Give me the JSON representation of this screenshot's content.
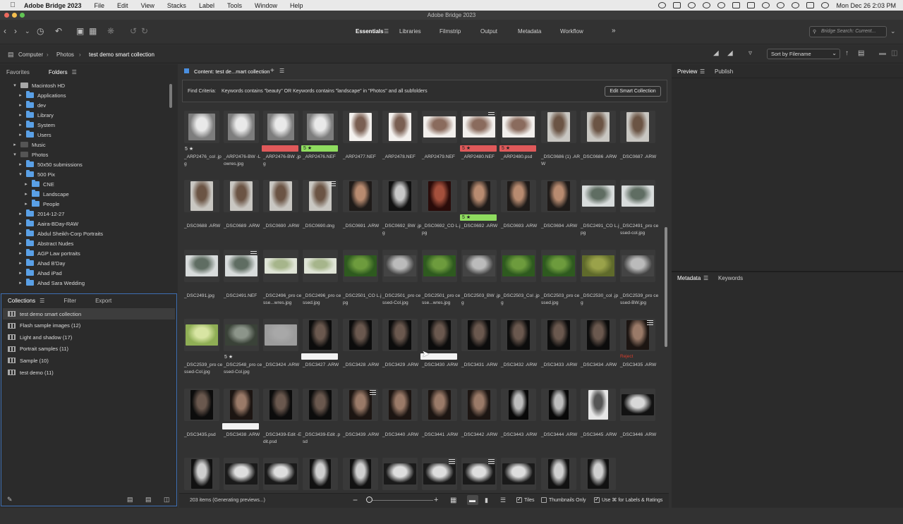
{
  "menubar": {
    "app_name": "Adobe Bridge 2023",
    "menus": [
      "File",
      "Edit",
      "View",
      "Stacks",
      "Label",
      "Tools",
      "Window",
      "Help"
    ],
    "clock": "Mon Dec 26  2:03 PM"
  },
  "window": {
    "title": "Adobe Bridge 2023"
  },
  "workspaces": {
    "items": [
      "Essentials",
      "Libraries",
      "Filmstrip",
      "Output",
      "Metadata",
      "Workflow"
    ],
    "active": "Essentials",
    "more": "»"
  },
  "search": {
    "placeholder": "Bridge Search: Current..."
  },
  "breadcrumb": [
    "Computer",
    "Photos",
    "test demo smart collection"
  ],
  "sort": {
    "label": "Sort by Filename"
  },
  "left_tabs": {
    "favorites": "Favorites",
    "folders": "Folders"
  },
  "folders": [
    {
      "label": "Macintosh HD",
      "level": 0,
      "open": true,
      "icon": "drive"
    },
    {
      "label": "Applications",
      "level": 1,
      "icon": "folder"
    },
    {
      "label": "dev",
      "level": 1,
      "icon": "folder"
    },
    {
      "label": "Library",
      "level": 1,
      "icon": "folder"
    },
    {
      "label": "System",
      "level": 1,
      "icon": "folder"
    },
    {
      "label": "Users",
      "level": 1,
      "icon": "folder"
    },
    {
      "label": "Music",
      "level": 0,
      "icon": "drive-dark"
    },
    {
      "label": "Photos",
      "level": 0,
      "open": true,
      "icon": "drive-dark"
    },
    {
      "label": "50x50 submissions",
      "level": 1,
      "icon": "folder"
    },
    {
      "label": "500 Pix",
      "level": 1,
      "open": true,
      "icon": "folder"
    },
    {
      "label": "CNE",
      "level": 2,
      "icon": "folder"
    },
    {
      "label": "Landscape",
      "level": 2,
      "icon": "folder"
    },
    {
      "label": "People",
      "level": 2,
      "icon": "folder"
    },
    {
      "label": "2014-12-27",
      "level": 1,
      "icon": "folder"
    },
    {
      "label": "Aaira-BDay-RAW",
      "level": 1,
      "icon": "folder"
    },
    {
      "label": "Abdul Sheikh-Corp Portraits",
      "level": 1,
      "icon": "folder"
    },
    {
      "label": "Abstract Nudes",
      "level": 1,
      "icon": "folder"
    },
    {
      "label": "AGP Law portraits",
      "level": 1,
      "icon": "folder"
    },
    {
      "label": "Ahad B'Day",
      "level": 1,
      "icon": "folder"
    },
    {
      "label": "Ahad iPad",
      "level": 1,
      "icon": "folder"
    },
    {
      "label": "Ahad Sara Wedding",
      "level": 1,
      "icon": "folder"
    }
  ],
  "collection_tabs": {
    "collections": "Collections",
    "filter": "Filter",
    "export": "Export"
  },
  "collections": [
    "test demo smart collection",
    "Flash sample images (12)",
    "Light and shadow (17)",
    "Portrait samples (11)",
    "Sample (10)",
    "test demo (11)"
  ],
  "content": {
    "tab_label": "Content: test de...mart collection",
    "find_label": "Find Criteria:",
    "find_criteria": "Keywords contains \"beauty\" OR Keywords contains \"landscape\" in \"Photos\" and all subfolders",
    "edit_button": "Edit Smart Collection"
  },
  "label_colors": {
    "red": "#e0595a",
    "green": "#8fdc5f",
    "white": "#f2f2f2"
  },
  "items": [
    {
      "name": "_ARP2476_col .jpg",
      "stars": "5 ★",
      "kind": "bw-portrait"
    },
    {
      "name": "_ARP2476-BW -Lowres.jpg",
      "kind": "bw-portrait"
    },
    {
      "name": "_ARP2476-BW .jpg",
      "label": "red",
      "kind": "bw-portrait"
    },
    {
      "name": "_ARP2476.NEF",
      "label": "green",
      "label_text": "5 ★",
      "kind": "bw-portrait"
    },
    {
      "name": "_ARP2477.NEF",
      "kind": "woman-light-tall"
    },
    {
      "name": "_ARP2478.NEF",
      "kind": "woman-light-tall"
    },
    {
      "name": "_ARP2479.NEF",
      "kind": "woman-light-wide"
    },
    {
      "name": "_ARP2480.NEF",
      "label": "red",
      "label_text": "5 ★",
      "stack": true,
      "kind": "woman-light-wide"
    },
    {
      "name": "_ARP2480.psd",
      "label": "red",
      "label_text": "5 ★",
      "kind": "woman-light-wide"
    },
    {
      "name": "_DSC0686 (1) .ARW",
      "kind": "man-shirt"
    },
    {
      "name": "_DSC0686 .ARW",
      "kind": "man-shirt"
    },
    {
      "name": "_DSC0687 .ARW",
      "kind": "man-shirt"
    },
    {
      "name": "_DSC0688 .ARW",
      "kind": "man-shirt"
    },
    {
      "name": "_DSC0689 .ARW",
      "kind": "man-shirt"
    },
    {
      "name": "_DSC0690 .ARW",
      "kind": "man-shirt"
    },
    {
      "name": "_DSC0690.dng",
      "stack": true,
      "kind": "man-shirt"
    },
    {
      "name": "_DSC0691 .ARW",
      "kind": "face-warm"
    },
    {
      "name": "_DSC0692_BW .jpg",
      "kind": "face-bw"
    },
    {
      "name": "_DSC0692_CO L.jpg",
      "kind": "face-red"
    },
    {
      "name": "_DSC0692 .ARW",
      "label": "green",
      "label_text": "5 ★",
      "kind": "face-warm"
    },
    {
      "name": "_DSC0693 .ARW",
      "kind": "face-warm"
    },
    {
      "name": "_DSC0694 .ARW",
      "kind": "face-warm"
    },
    {
      "name": "_DSC2491_CO L.jpg",
      "kind": "lake-wide"
    },
    {
      "name": "_DSC2491_pro cessed-col.jpg",
      "kind": "lake-wide"
    },
    {
      "name": "_DSC2491.jpg",
      "kind": "lake-wide"
    },
    {
      "name": "_DSC2491.NEF",
      "stack": true,
      "kind": "lake-wide"
    },
    {
      "name": "_DSC2496_pro cesse...wres.jpg",
      "kind": "grass-pale"
    },
    {
      "name": "_DSC2496_pro cessed.jpg",
      "kind": "grass-pale"
    },
    {
      "name": "_DSC2501_CO L.jpg",
      "kind": "green-field"
    },
    {
      "name": "_DSC2501_pro cessed-Col.jpg",
      "kind": "bw-field"
    },
    {
      "name": "_DSC2501_pro cesse...wres.jpg",
      "kind": "green-field"
    },
    {
      "name": "_DSC2503_BW .jpg",
      "kind": "bw-field"
    },
    {
      "name": "_DSC2503_Col .jpg",
      "kind": "green-field"
    },
    {
      "name": "_DSC2503_pro cessed.jpg",
      "kind": "green-field"
    },
    {
      "name": "_DSC2530_col .jpg",
      "kind": "olive-field"
    },
    {
      "name": "_DSC2539_pro cessed-BW.jpg",
      "kind": "bw-field"
    },
    {
      "name": "_DSC2539_pro cessed-Col.jpg",
      "kind": "tree-green"
    },
    {
      "name": "_DSC2548_pro cessed-Col.jpg",
      "stars": "5 ★",
      "kind": "rocks"
    },
    {
      "name": "_DSC3424 .ARW",
      "kind": "gray-blank"
    },
    {
      "name": "_DSC3427 .ARW",
      "label": "white",
      "kind": "dark-portrait"
    },
    {
      "name": "_DSC3428 .ARW",
      "kind": "dark-portrait"
    },
    {
      "name": "_DSC3429 .ARW",
      "kind": "dark-portrait"
    },
    {
      "name": "_DSC3430 .ARW",
      "label": "white",
      "kind": "dark-portrait"
    },
    {
      "name": "_DSC3431 .ARW",
      "kind": "dark-portrait"
    },
    {
      "name": "_DSC3432 .ARW",
      "kind": "dark-portrait"
    },
    {
      "name": "_DSC3433 .ARW",
      "kind": "dark-portrait"
    },
    {
      "name": "_DSC3434 .ARW",
      "kind": "dark-portrait"
    },
    {
      "name": "_DSC3435 .ARW",
      "reject": "Reject",
      "stack": true,
      "kind": "dark-portrait-warm"
    },
    {
      "name": "_DSC3435.psd",
      "kind": "dark-portrait"
    },
    {
      "name": "_DSC3438 .ARW",
      "label": "white",
      "kind": "dark-portrait-warm"
    },
    {
      "name": "_DSC3439-Edit -Edit.psd",
      "kind": "dark-portrait"
    },
    {
      "name": "_DSC3439-Edit .psd",
      "kind": "dark-portrait"
    },
    {
      "name": "_DSC3439 .ARW",
      "stack": true,
      "kind": "dark-portrait-warm"
    },
    {
      "name": "_DSC3440 .ARW",
      "kind": "dark-portrait-warm"
    },
    {
      "name": "_DSC3441 .ARW",
      "kind": "dark-portrait-warm"
    },
    {
      "name": "_DSC3442 .ARW",
      "kind": "dark-portrait-warm"
    },
    {
      "name": "_DSC3443 .ARW",
      "kind": "bw-dark-figure"
    },
    {
      "name": "_DSC3444 .ARW",
      "kind": "bw-dark-figure"
    },
    {
      "name": "_DSC3445 .ARW",
      "kind": "bw-light-figure"
    },
    {
      "name": "_DSC3446 .ARW",
      "kind": "bw-interior"
    },
    {
      "name": "",
      "kind": "bw-arch"
    },
    {
      "name": "",
      "kind": "bw-arch-wide"
    },
    {
      "name": "",
      "kind": "bw-arch-wide"
    },
    {
      "name": "",
      "kind": "bw-arch"
    },
    {
      "name": "",
      "kind": "bw-arch"
    },
    {
      "name": "",
      "kind": "bw-arch-wide"
    },
    {
      "name": "",
      "stack": true,
      "kind": "bw-arch-wide"
    },
    {
      "name": "",
      "stack": true,
      "kind": "bw-arch-wide"
    },
    {
      "name": "",
      "kind": "bw-arch-wide"
    },
    {
      "name": "",
      "kind": "bw-arch"
    },
    {
      "name": "",
      "kind": "bw-arch"
    }
  ],
  "right_tabs": {
    "preview": "Preview",
    "publish": "Publish",
    "metadata": "Metadata",
    "keywords": "Keywords"
  },
  "status": {
    "count": "203 items (Generating previews...)",
    "tiles": "Tiles",
    "thumbnails_only": "Thumbnails Only",
    "use_cmd": "Use ⌘ for Labels & Ratings"
  }
}
